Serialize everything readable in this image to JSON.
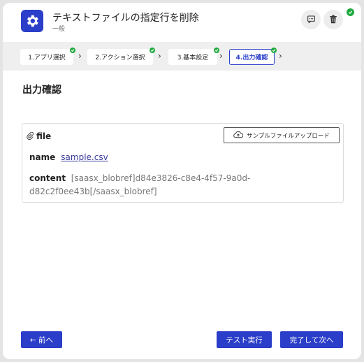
{
  "header": {
    "title": "テキストファイルの指定行を削除",
    "subtitle": "一般",
    "icons": [
      "gear-icon",
      "comment-icon",
      "trash-icon",
      "check-icon"
    ]
  },
  "steps": [
    {
      "label": "1.アプリ選択",
      "done": true
    },
    {
      "label": "2.アクション選択",
      "done": true
    },
    {
      "label": "3.基本設定",
      "done": true
    },
    {
      "label": "4.出力確認",
      "done": true,
      "active": true
    }
  ],
  "main": {
    "section_title": "出力確認",
    "file": {
      "label": "file",
      "upload_button": "サンプルファイルアップロード",
      "name_key": "name",
      "name_value": "sample.csv",
      "content_key": "content",
      "content_value": "[saasx_blobref]d84e3826-c8e4-4f57-9a0d-d82c2f0ee43b[/saasx_blobref]"
    }
  },
  "footer": {
    "back_label": "← 前へ",
    "test_label": "テスト実行",
    "next_label": "完了して次へ"
  },
  "colors": {
    "accent": "#2a3ec9",
    "success": "#1faa3e",
    "stepper_bg": "#efefef"
  }
}
